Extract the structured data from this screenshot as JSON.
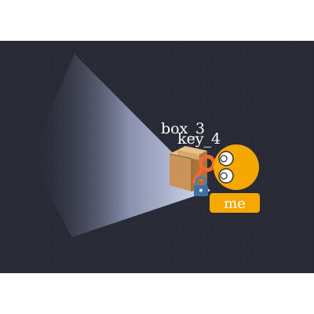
{
  "scene": {
    "objects": [
      {
        "kind": "box",
        "label": "box_3",
        "icon": "cardboard-box-icon"
      },
      {
        "kind": "key",
        "label": "key_4",
        "icon": "key-icon"
      },
      {
        "kind": "lock",
        "icon": "padlock-icon"
      }
    ],
    "player": {
      "label": "me",
      "icon": "smiley-face-icon",
      "color": "#f5a800"
    },
    "colors": {
      "background": "#272a35",
      "light_beam": "#c9d0ec",
      "key": "#f06a2c",
      "lock": "#3e6fa0"
    }
  }
}
